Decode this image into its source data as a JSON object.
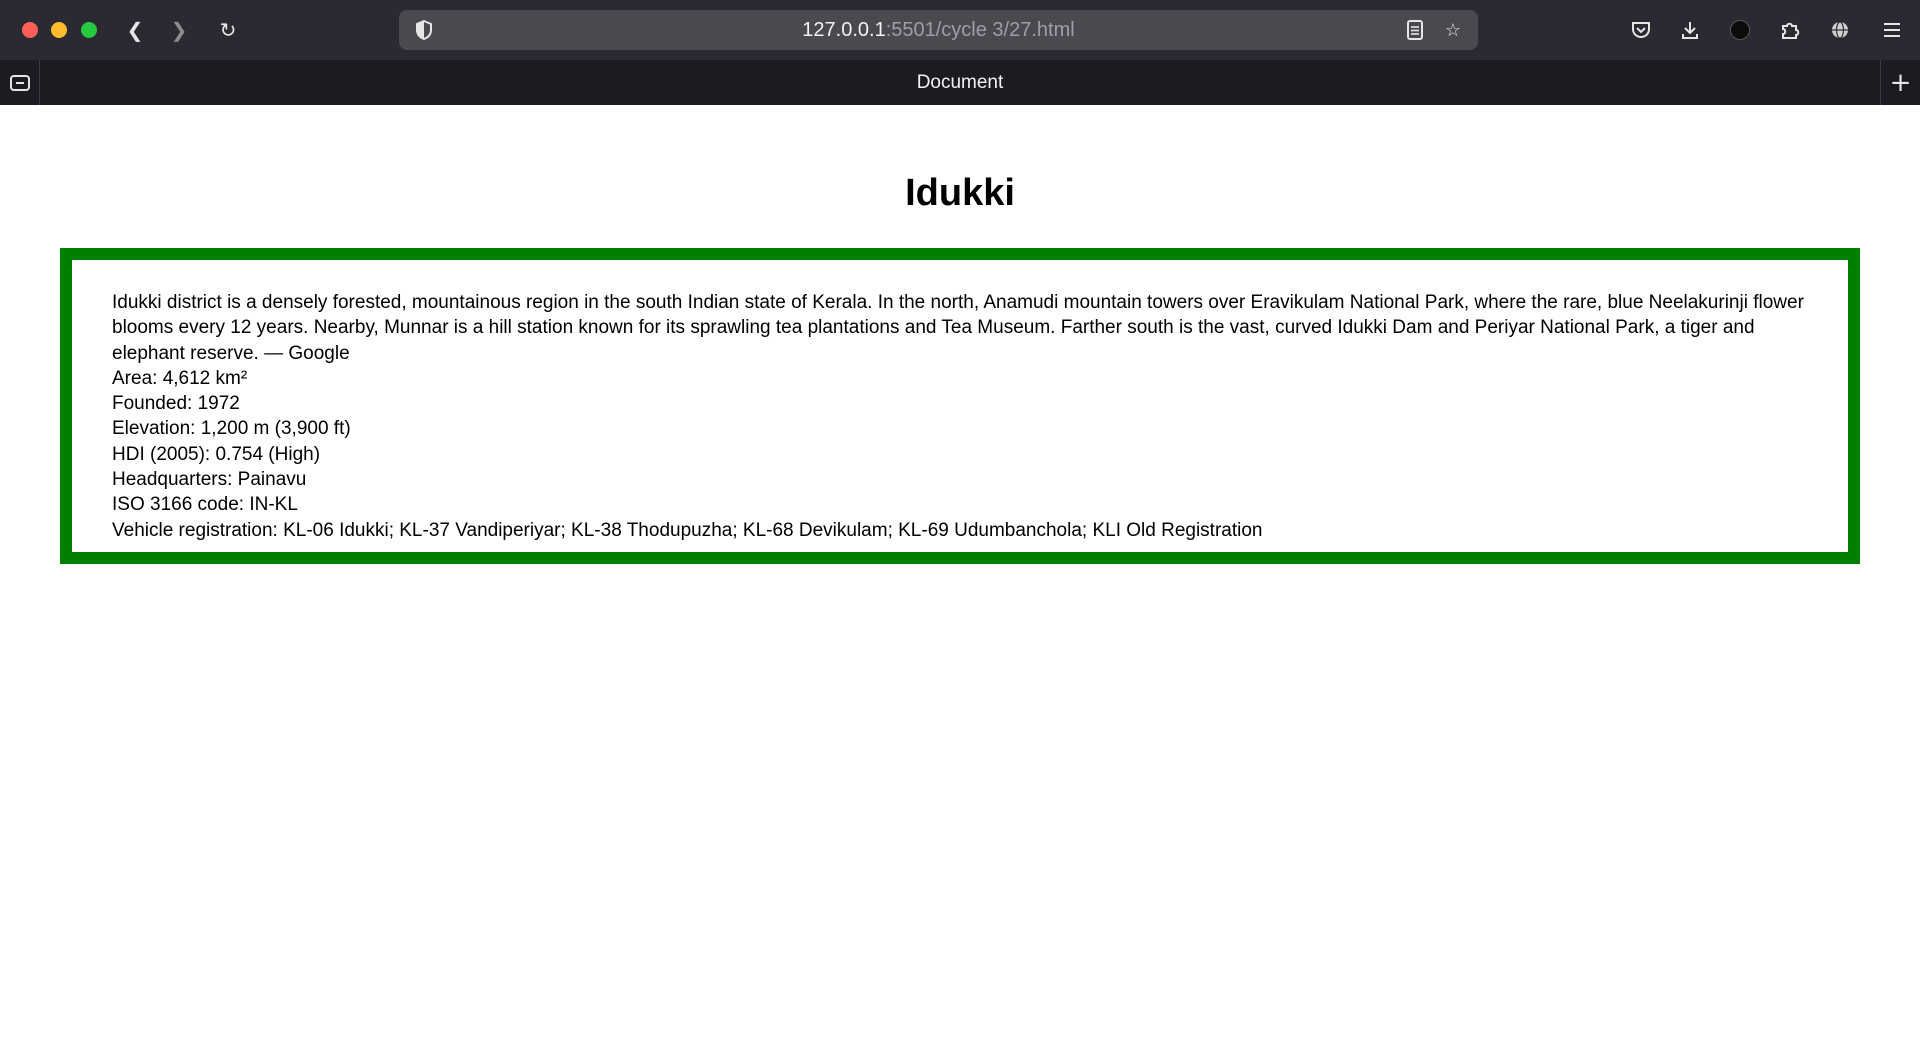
{
  "browser": {
    "url_host": "127.0.0.1",
    "url_path": ":5501/cycle 3/27.html",
    "tab_title": "Document",
    "icons": {
      "back": "back-arrow-icon",
      "forward": "forward-arrow-icon",
      "reload": "reload-icon",
      "shield": "shield-icon",
      "page": "page-icon",
      "reader": "reader-view-icon",
      "bookmark": "star-icon",
      "pocket": "pocket-icon",
      "download": "download-icon",
      "account": "account-icon",
      "extensions": "puzzle-icon",
      "globe": "globe-icon",
      "menu": "hamburger-menu-icon",
      "tab_overview": "tab-overview-icon",
      "new_tab": "plus-icon"
    }
  },
  "page": {
    "heading": "Idukki",
    "description": "Idukki district is a densely forested, mountainous region in the south Indian state of Kerala. In the north, Anamudi mountain towers over Eravikulam National Park, where the rare, blue Neelakurinji flower blooms every 12 years. Nearby, Munnar is a hill station known for its sprawling tea plantations and Tea Museum. Farther south is the vast, curved Idukki Dam and Periyar National Park, a tiger and elephant reserve. — Google",
    "facts": [
      "Area: 4,612 km²",
      "Founded: 1972",
      "Elevation: 1,200 m (3,900 ft)",
      "HDI (2005): 0.754 (High)",
      "Headquarters: Painavu",
      "ISO 3166 code: IN-KL",
      "Vehicle registration: KL-06 Idukki; KL-37 Vandiperiyar; KL-38 Thodupuzha; KL-68 Devikulam; KL-69 Udumbanchola; KLI Old Registration"
    ],
    "box_border_color": "#008000"
  }
}
